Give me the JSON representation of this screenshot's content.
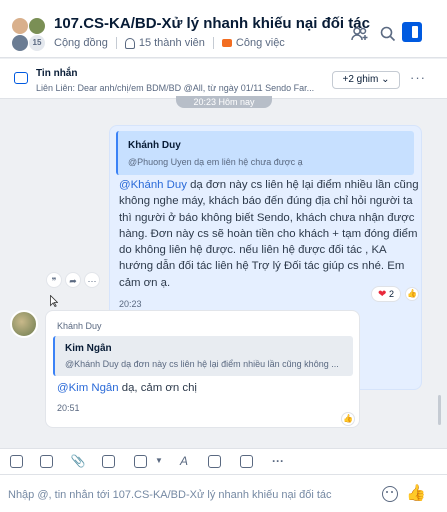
{
  "header": {
    "title": "107.CS-KA/BD-Xử lý nhanh khiếu nại đối tác",
    "member_badge": "15",
    "community": "Cộng đồng",
    "members": "15 thành viên",
    "category": "Công việc",
    "icons": [
      "add-group-icon",
      "search-icon",
      "panel-toggle-icon"
    ]
  },
  "pinned": {
    "title": "Tin nhắn",
    "preview": "Liên Liên: Dear anh/chị/em BDM/BD @All, từ ngày 01/11 Sendo Far...",
    "more_label": "+2 ghim ⌄",
    "dots": "···"
  },
  "divider": {
    "time": "20:23 Hôm nay"
  },
  "messages": [
    {
      "quote_name": "Khánh Duy",
      "quote_text": "@Phuong Uyen dạ em liên hệ chưa được ạ",
      "mention": "@Khánh Duy",
      "text": " dạ đơn này cs liên hệ lại điểm nhiều lần cũng không nghe máy, khách báo đến đúng địa chỉ hỏi người ta thì người ở báo không biết Sendo, khách chưa nhận được hàng. Đơn này cs sẽ hoàn tiền cho khách + tạm đóng điểm do không liên hệ được. nếu liên hệ được đối tác , KA hướng dẫn đối tác liên hệ Trợ lý Đối tác giúp cs nhé. Em cảm ơn ạ.",
      "time": "20:23",
      "reaction_count": "2",
      "actions": [
        "quote-icon",
        "forward-icon",
        "more-icon"
      ]
    },
    {
      "sender": "Khánh Duy",
      "quote_name": "Kim Ngân",
      "quote_text": "@Khánh Duy dạ đơn này cs liên hệ lại điểm nhiều lần cũng không ...",
      "mention": "@Kim Ngân",
      "text": " dạ, cảm ơn chị",
      "time": "20:51"
    }
  ],
  "toolbar": {
    "icons": [
      "sticker-icon",
      "image-icon",
      "attachment-icon",
      "contact-card-icon",
      "screenshot-icon",
      "format-icon",
      "quick-message-icon",
      "reminder-icon",
      "more-icon"
    ],
    "more": "···"
  },
  "input": {
    "placeholder": "Nhập @, tin nhắn tới 107.CS-KA/BD-Xử lý nhanh khiếu nại đối tác"
  },
  "colors": {
    "accent": "#005ae0",
    "bubble_self": "#e5efff",
    "mention": "#2a6ad8",
    "heart": "#e8293b"
  }
}
